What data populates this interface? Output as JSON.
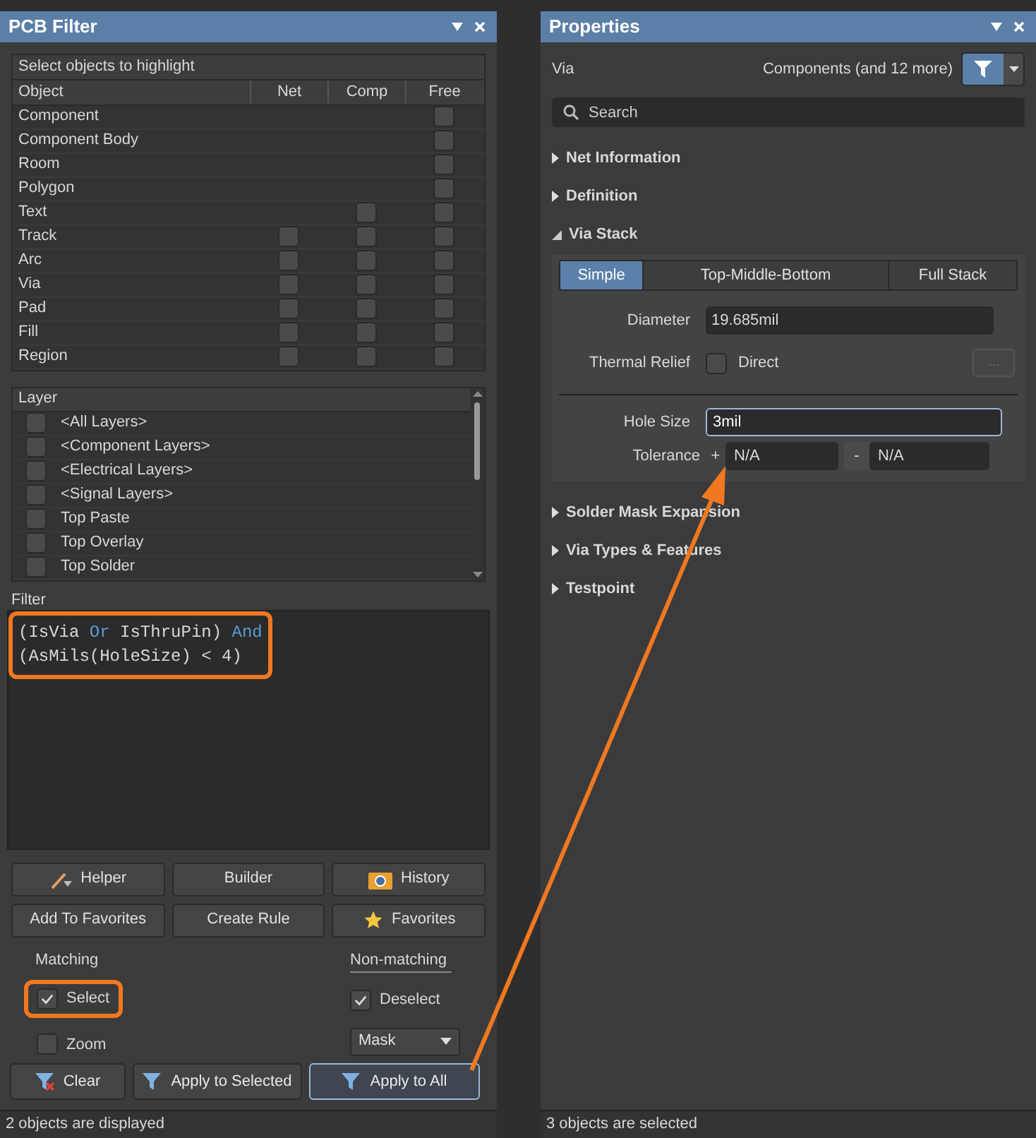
{
  "pcb_filter": {
    "title": "PCB Filter",
    "objects": {
      "title": "Select objects to highlight",
      "columns": [
        "Object",
        "Net",
        "Comp",
        "Free"
      ],
      "rows": [
        {
          "name": "Component",
          "free": false
        },
        {
          "name": "Component Body",
          "free": false
        },
        {
          "name": "Room",
          "free": false
        },
        {
          "name": "Polygon",
          "free": false
        },
        {
          "name": "Text",
          "comp": false,
          "free": false
        },
        {
          "name": "Track",
          "net": false,
          "comp": false,
          "free": false
        },
        {
          "name": "Arc",
          "net": false,
          "comp": false,
          "free": false
        },
        {
          "name": "Via",
          "net": false,
          "comp": false,
          "free": false
        },
        {
          "name": "Pad",
          "net": false,
          "comp": false,
          "free": false
        },
        {
          "name": "Fill",
          "net": false,
          "comp": false,
          "free": false
        },
        {
          "name": "Region",
          "net": false,
          "comp": false,
          "free": false
        }
      ]
    },
    "layers": {
      "title": "Layer",
      "items": [
        {
          "name": "<All Layers>",
          "checked": false
        },
        {
          "name": "<Component Layers>",
          "checked": false
        },
        {
          "name": "<Electrical Layers>",
          "checked": false
        },
        {
          "name": "<Signal Layers>",
          "checked": false
        },
        {
          "name": "Top Paste",
          "checked": false
        },
        {
          "name": "Top Overlay",
          "checked": false
        },
        {
          "name": "Top Solder",
          "checked": false
        }
      ]
    },
    "filter": {
      "label": "Filter",
      "highlighted": true,
      "lines": [
        [
          {
            "kind": "text",
            "text": "(IsVia "
          },
          {
            "kind": "keyword",
            "text": "Or"
          },
          {
            "kind": "text",
            "text": " IsThruPin) "
          },
          {
            "kind": "keyword",
            "text": "And"
          }
        ],
        [
          {
            "kind": "text",
            "text": "(AsMils(HoleSize) < 4)"
          }
        ]
      ]
    },
    "buttons": [
      {
        "label": "Helper"
      },
      {
        "label": "Builder"
      },
      {
        "label": "History"
      },
      {
        "label": "Add To Favorites"
      },
      {
        "label": "Create Rule"
      },
      {
        "label": "Favorites"
      }
    ],
    "matching": {
      "title": "Matching",
      "options": [
        {
          "label": "Select",
          "checked": true,
          "highlighted": true
        },
        {
          "label": "Zoom",
          "checked": false,
          "highlighted": false
        }
      ]
    },
    "non_matching": {
      "title": "Non-matching",
      "option": {
        "label": "Deselect",
        "checked": true
      },
      "mode": "Mask"
    },
    "actions": [
      {
        "label": "Clear",
        "selected": false
      },
      {
        "label": "Apply to Selected",
        "selected": false
      },
      {
        "label": "Apply to All",
        "selected": true
      }
    ],
    "status_bar": "2 objects are displayed"
  },
  "properties": {
    "title": "Properties",
    "object": "Via",
    "scope": "Components (and 12 more)",
    "search": {
      "placeholder": "Search"
    },
    "sections_before": [
      {
        "label": "Net Information",
        "expanded": false
      },
      {
        "label": "Definition",
        "expanded": false
      },
      {
        "label": "Via Stack",
        "expanded": true
      }
    ],
    "via_stack": {
      "tabs": [
        {
          "label": "Simple",
          "selected": true
        },
        {
          "label": "Top-Middle-Bottom",
          "selected": false
        },
        {
          "label": "Full Stack",
          "selected": false
        }
      ],
      "diameter": {
        "label": "Diameter",
        "value": "19.685mil"
      },
      "thermal_relief": {
        "label": "Thermal Relief",
        "option": "Direct",
        "checked": false,
        "more": "..."
      },
      "hole_size": {
        "label": "Hole Size",
        "value": "3mil"
      },
      "tolerance": {
        "label": "Tolerance",
        "plus": "+",
        "plus_value": "N/A",
        "minus": "-",
        "minus_value": "N/A"
      }
    },
    "sections_after": [
      {
        "label": "Solder Mask Expansion",
        "expanded": false
      },
      {
        "label": "Via Types & Features",
        "expanded": false
      },
      {
        "label": "Testpoint",
        "expanded": false
      }
    ],
    "status_bar": "3 objects are selected"
  },
  "annotation": {
    "arrow": true
  }
}
